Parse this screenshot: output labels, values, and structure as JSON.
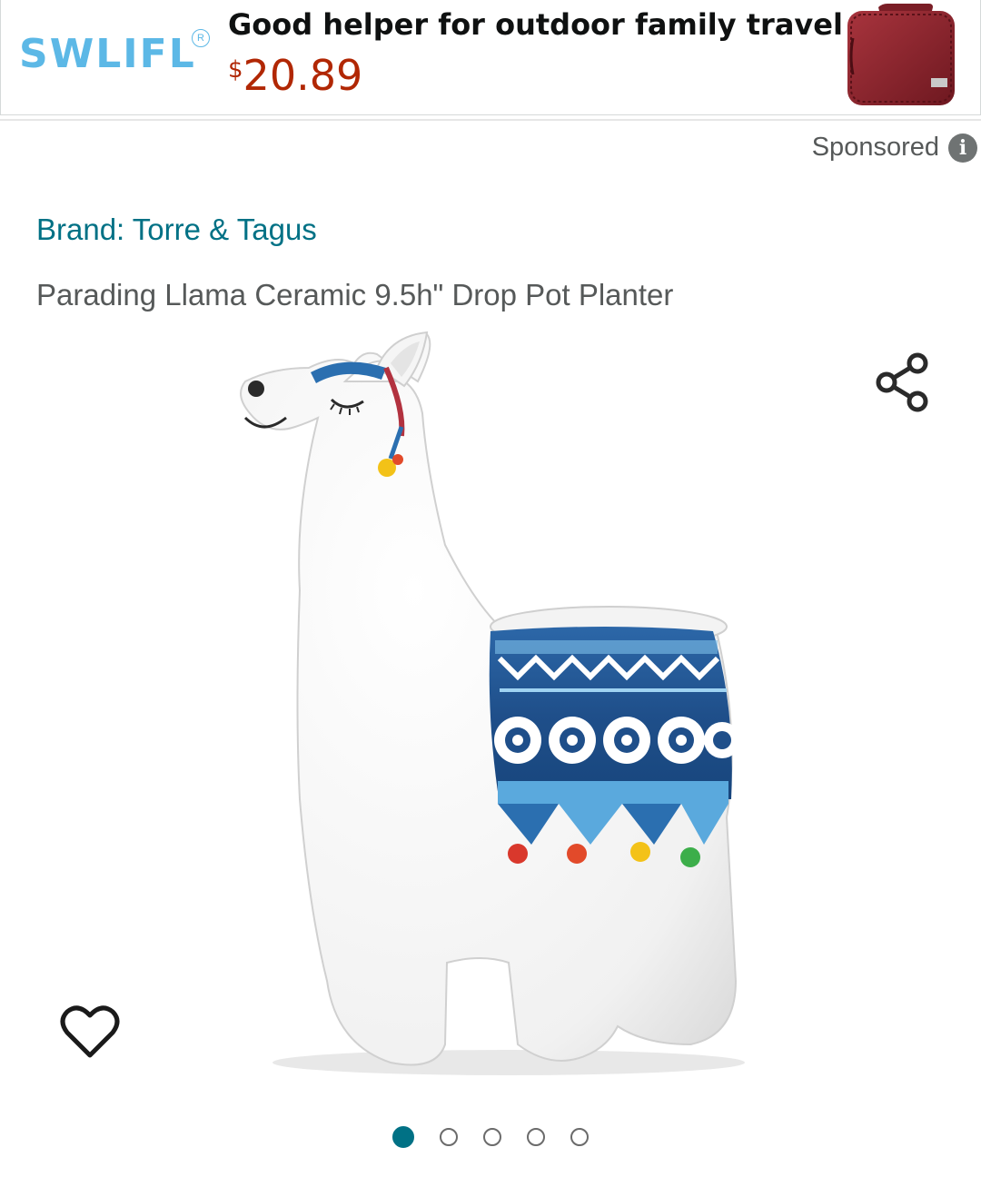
{
  "ad": {
    "brand": "SWLIFL",
    "brand_mark": "R",
    "headline": "Good helper for outdoor family travel",
    "price_currency": "$",
    "price_amount": "20.89",
    "thumbnail_icon": "red-travel-organizer-bag"
  },
  "sponsored": {
    "label": "Sponsored",
    "info_glyph": "i"
  },
  "product": {
    "brand_label": "Brand: Torre & Tagus",
    "title": "Parading Llama Ceramic 9.5h\" Drop Pot Planter",
    "image_icon": "llama-planter-image"
  },
  "actions": {
    "share_icon": "share-icon",
    "wishlist_icon": "heart-outline-icon"
  },
  "carousel": {
    "total": 5,
    "active_index": 0
  },
  "colors": {
    "link": "#007185",
    "price": "#b12704",
    "brand_ad": "#5cb8e6",
    "text_secondary": "#565959"
  }
}
